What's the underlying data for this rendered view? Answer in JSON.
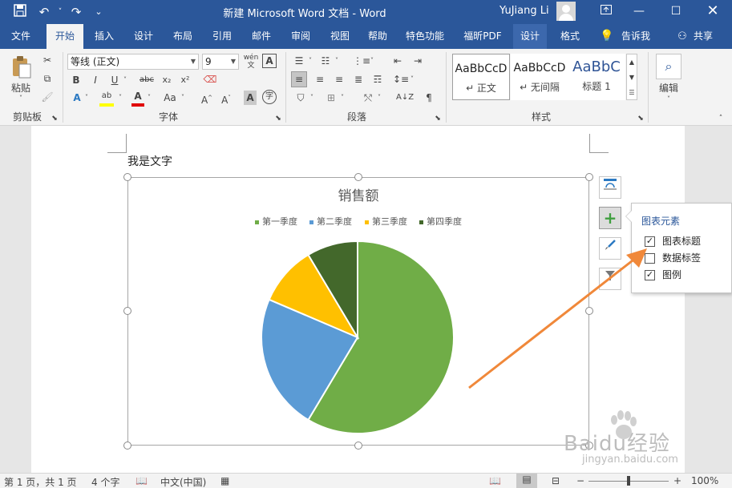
{
  "titlebar": {
    "doc_title": "新建 Microsoft Word 文档  -  Word",
    "user_name": "YuJiang Li",
    "save_icon": "save-icon",
    "undo_icon": "undo-icon",
    "redo_icon": "redo-icon"
  },
  "tabs": [
    "文件",
    "开始",
    "插入",
    "设计",
    "布局",
    "引用",
    "邮件",
    "审阅",
    "视图",
    "帮助",
    "特色功能",
    "福昕PDF",
    "设计",
    "格式",
    "告诉我",
    "共享"
  ],
  "ribbon": {
    "clipboard": {
      "paste_label": "粘贴",
      "group_label": "剪贴板"
    },
    "font": {
      "font_name": "等线 (正文)",
      "font_size": "9",
      "group_label": "字体"
    },
    "paragraph": {
      "group_label": "段落"
    },
    "styles": {
      "group_label": "样式",
      "cards": [
        {
          "preview": "AaBbCcD",
          "name": "↵ 正文"
        },
        {
          "preview": "AaBbCcD",
          "name": "↵ 无间隔"
        },
        {
          "preview": "AaBbC",
          "name": "标题 1"
        }
      ]
    },
    "editing": {
      "label": "编辑"
    }
  },
  "document": {
    "text": "我是文字"
  },
  "chart_data": {
    "type": "pie",
    "title": "销售额",
    "categories": [
      "第一季度",
      "第二季度",
      "第三季度",
      "第四季度"
    ],
    "values": [
      8.2,
      3.2,
      1.4,
      1.2
    ],
    "colors": [
      "#70ad47",
      "#5b9bd5",
      "#ffc000",
      "#43682b"
    ],
    "legend_position": "top"
  },
  "chart_elements_popup": {
    "title": "图表元素",
    "options": [
      {
        "label": "图表标题",
        "checked": true
      },
      {
        "label": "数据标签",
        "checked": false
      },
      {
        "label": "图例",
        "checked": true
      }
    ]
  },
  "watermark": {
    "logo_text": "Baidu经验",
    "url": "jingyan.baidu.com"
  },
  "statusbar": {
    "page": "第 1 页，共 1 页",
    "words": "4 个字",
    "language": "中文(中国)",
    "zoom": "100%"
  },
  "colors": {
    "accent": "#2b579a",
    "arrow": "#f0883a"
  }
}
